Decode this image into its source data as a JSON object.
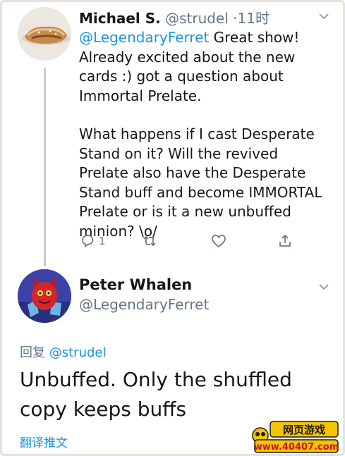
{
  "tweet": {
    "author_name": "Michael S.",
    "author_handle": "@strudel",
    "separator": "·",
    "time": "11时",
    "mention": "@LegendaryFerret",
    "text_after_mention": " Great show! Already excited about the new cards :) got a question about Immortal Prelate.",
    "text_paragraph_2": "What happens if I cast Desperate Stand on it? Will the revived Prelate also have the Desperate Stand buff and become IMMORTAL Prelate or is it a new unbuffed minion? \\o/",
    "reply_count": "1"
  },
  "reply": {
    "author_name": "Peter Whalen",
    "author_handle": "@LegendaryFerret",
    "reply_label": "回复",
    "reply_to": "@strudel",
    "text": "Unbuffed. Only the shuffled copy keeps buffs",
    "translate_label": "翻译推文"
  },
  "watermark": {
    "line1": "网页游戏",
    "line2": "www.40407.com"
  },
  "icons": {
    "reply": "reply-icon",
    "retweet": "retweet-icon",
    "like": "heart-icon",
    "share": "share-icon",
    "more": "chevron-down-icon"
  },
  "colors": {
    "accent": "#1b95e0",
    "muted": "#657786",
    "text": "#14171a",
    "thread_line": "#c4ced6"
  }
}
